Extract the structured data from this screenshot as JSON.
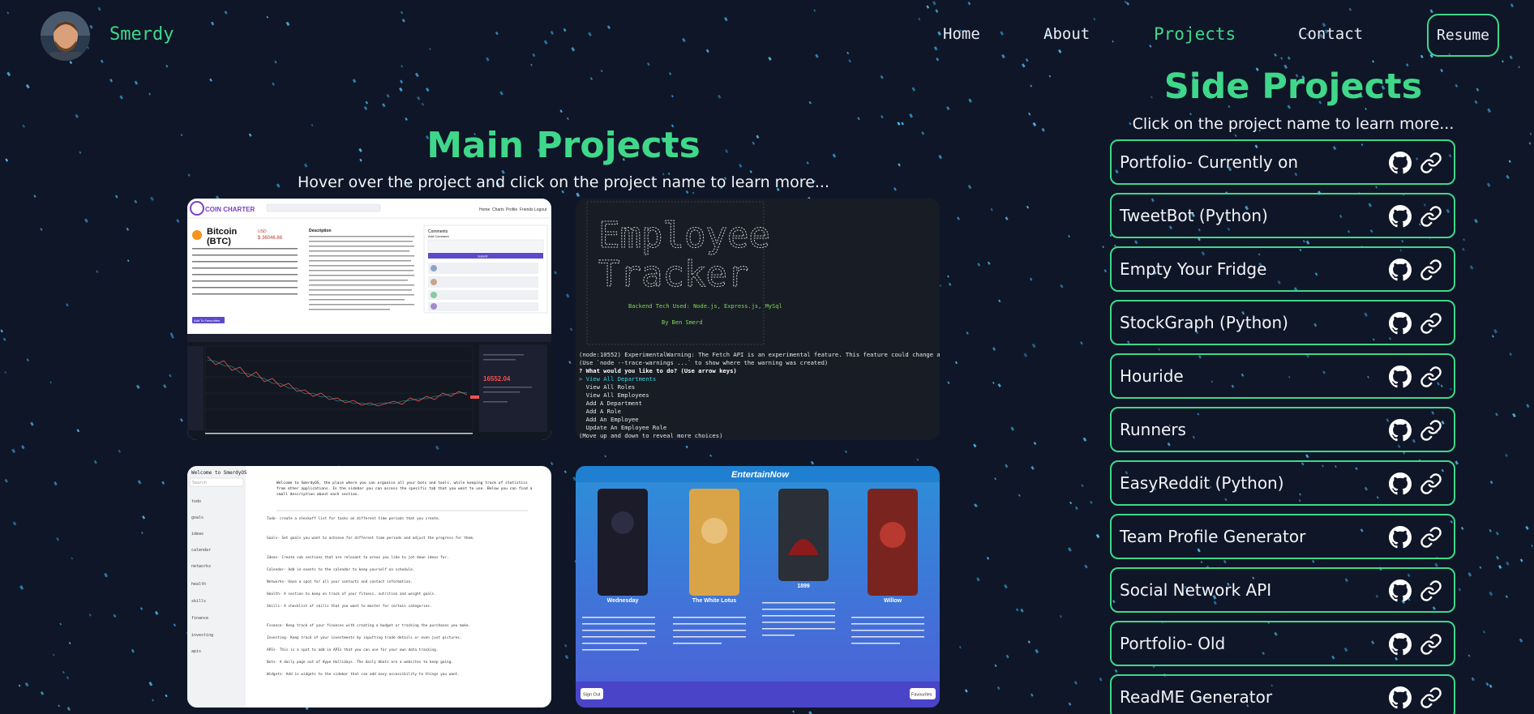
{
  "brand": {
    "name": "Smerdy"
  },
  "nav": {
    "items": [
      {
        "label": "Home"
      },
      {
        "label": "About"
      },
      {
        "label": "Projects",
        "active": true
      },
      {
        "label": "Contact"
      }
    ],
    "resume_label": "Resume"
  },
  "colors": {
    "accent": "#3fd88a",
    "background": "#0f1627",
    "text": "#f2f4f8"
  },
  "main_projects": {
    "title": "Main Projects",
    "subtitle": "Hover over the project and click on the project name to learn more...",
    "cards": [
      {
        "logo": "COIN CHARTER",
        "nav": [
          "Home",
          "Charts",
          "Profile",
          "Friends",
          "Logout"
        ],
        "coin": "Bitcoin",
        "ticker": "(BTC)",
        "currency": "USD",
        "price": "$ 36046.86",
        "description_heading": "Description",
        "comments_heading": "Comments",
        "add_comment": "Add Comment",
        "submit": "Submit",
        "favorites_button": "Add To Favourites",
        "chart_price": "16552.04"
      },
      {
        "ascii_line1": "Employee",
        "ascii_line2": "Tracker",
        "tech_line": "Backend Tech Used: Node.js, Express.js, MySql",
        "author_line": "By Ben Smerd",
        "terminal_lines": [
          "(node:10552) ExperimentalWarning: The Fetch API is an experimental feature. This feature could change at any time",
          "(Use `node --trace-warnings ...` to show where the warning was created)",
          "? What would you like to do? (Use arrow keys)",
          "> View All Departments",
          "  View All Roles",
          "  View All Employees",
          "  Add A Department",
          "  Add A Role",
          "  Add An Employee",
          "  Update An Employee Role",
          "(Move up and down to reveal more choices)"
        ]
      },
      {
        "welcome": "Welcome to SmerdyOS",
        "search_placeholder": "Search",
        "sidebar": [
          "todo",
          "goals",
          "ideas",
          "calendar",
          "networks",
          "health",
          "skills",
          "finance",
          "investing",
          "apis"
        ],
        "heading": "Welcome to SmerdyOS, the place where you can organise all your bots and tools, while keeping track of statistics from other applications. In the sidebar you can access the specific tab that you want to use. Below you can find a small description about each section.",
        "lines": [
          "Todo- create a checkoff list for tasks on different time periods that you create.",
          "Goals- Set goals you want to achieve for different time periods and adjust the progress for them.",
          "Ideas- Create sub sections that are relevant to areas you like to jot down ideas for.",
          "Calendar- Add in events to the calendar to keep yourself on schedule.",
          "Networks- Have a spot for all your contacts and contact information.",
          "Health- A section to keep on track of your fitness, nutrition and weight goals.",
          "Skills- A checklist of skills that you want to master for certain categories.",
          "Finance- Keep track of your finances with creating a budget or tracking the purchases you make.",
          "Investing- Keep track of your investments by inputting trade details or even just pictures.",
          "APIs- This is a spot to add in APIs that you can use for your own data tracking.",
          "Bots- A daily page out of Hype Hollidays. The daily bbots are a websites to keep going.",
          "Widgets- Add in widgets to the sidebar that can add easy accessibility to things you want."
        ]
      },
      {
        "title": "EntertainNow",
        "shows": [
          {
            "name": "Wednesday",
            "year": "2022"
          },
          {
            "name": "The White Lotus",
            "year": "2021"
          },
          {
            "name": "1899",
            "year": "2022"
          },
          {
            "name": "Willow",
            "year": "2022"
          }
        ],
        "sign_out": "Sign Out",
        "favourites": "Favourites"
      }
    ]
  },
  "side_projects": {
    "title": "Side Projects",
    "subtitle": "Click on the project name to learn more...",
    "items": [
      {
        "name": "Portfolio- Currently on"
      },
      {
        "name": "TweetBot (Python)"
      },
      {
        "name": "Empty Your Fridge"
      },
      {
        "name": "StockGraph (Python)"
      },
      {
        "name": "Houride"
      },
      {
        "name": "Runners"
      },
      {
        "name": "EasyReddit (Python)"
      },
      {
        "name": "Team Profile Generator"
      },
      {
        "name": "Social Network API"
      },
      {
        "name": "Portfolio- Old"
      },
      {
        "name": "ReadME Generator"
      }
    ],
    "github_icon": "github-icon",
    "link_icon": "link-icon"
  }
}
